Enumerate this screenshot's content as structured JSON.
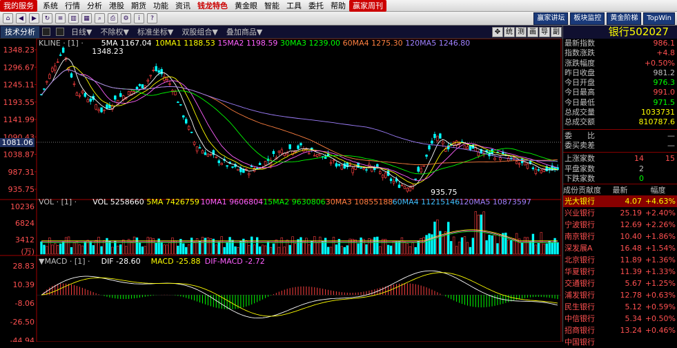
{
  "menubar": {
    "items": [
      "我的服务",
      "系统",
      "行情",
      "分析",
      "港股",
      "期货",
      "功能",
      "资讯",
      "钱龙特色",
      "黄金眼",
      "智能",
      "工具",
      "委托",
      "帮助",
      "赢家周刊"
    ]
  },
  "toolbar": {
    "right_buttons": [
      "赢家讲坛",
      "板块监控",
      "黄金阶梯",
      "TopWin"
    ]
  },
  "subbar": {
    "tab": "技术分析",
    "items": [
      "日线▼",
      "不除权▼",
      "标准坐标▼",
      "双股组合▼",
      "叠加商品▼"
    ],
    "right_buttons": [
      "✥",
      "统",
      "测",
      "画",
      "导",
      "副"
    ]
  },
  "stock": {
    "title": "银行502027"
  },
  "quote": [
    {
      "k": "最新指数",
      "v": "986.1",
      "c": "#ff5050"
    },
    {
      "k": "指数涨跌",
      "v": "+4.8",
      "c": "#ff5050"
    },
    {
      "k": "涨跌幅度",
      "v": "+0.50%",
      "c": "#ff5050"
    },
    {
      "k": "昨日收盘",
      "v": "981.2",
      "c": "#c0c0c0"
    },
    {
      "k": "今日开盘",
      "v": "976.3",
      "c": "#00ff00"
    },
    {
      "k": "今日最高",
      "v": "991.0",
      "c": "#ff5050"
    },
    {
      "k": "今日最低",
      "v": "971.5",
      "c": "#00ff00"
    },
    {
      "k": "总成交量",
      "v": "1033731",
      "c": "#ffff00"
    },
    {
      "k": "总成交额",
      "v": "810787.6",
      "c": "#ffff00"
    }
  ],
  "compare": [
    {
      "k": "委　　比",
      "v": "—"
    },
    {
      "k": "委买卖差",
      "v": "—"
    }
  ],
  "breadth": [
    {
      "k": "上涨家数",
      "v": "14",
      "v2": "15",
      "c": "#ff5050"
    },
    {
      "k": "平盘家数",
      "v": "2",
      "v2": "",
      "c": "#c0c0c0"
    },
    {
      "k": "下跌家数",
      "v": "0",
      "v2": "",
      "c": "#00ff00"
    }
  ],
  "contrib": {
    "headers": [
      "成份贡献度",
      "最新",
      "幅度"
    ],
    "rows": [
      {
        "n": "光大银行",
        "p": "4.07",
        "c": "+4.63%"
      },
      {
        "n": "兴业银行",
        "p": "25.19",
        "c": "+2.40%"
      },
      {
        "n": "宁波银行",
        "p": "12.69",
        "c": "+2.26%"
      },
      {
        "n": "南京银行",
        "p": "10.40",
        "c": "+1.86%"
      },
      {
        "n": "深发展A",
        "p": "16.48",
        "c": "+1.54%"
      },
      {
        "n": "北京银行",
        "p": "11.89",
        "c": "+1.36%"
      },
      {
        "n": "华夏银行",
        "p": "11.39",
        "c": "+1.33%"
      },
      {
        "n": "交通银行",
        "p": "5.67",
        "c": "+1.25%"
      },
      {
        "n": "浦发银行",
        "p": "12.78",
        "c": "+0.63%"
      },
      {
        "n": "民生银行",
        "p": "5.12",
        "c": "+0.59%"
      },
      {
        "n": "中信银行",
        "p": "5.34",
        "c": "+0.50%"
      },
      {
        "n": "招商银行",
        "p": "13.24",
        "c": "+0.46%"
      },
      {
        "n": "中国银行",
        "p": "",
        "c": ""
      }
    ]
  },
  "chart_data": [
    {
      "type": "line",
      "name": "kline",
      "legend": [
        {
          "t": "KLINE · [1] ·",
          "c": "#c0c0c0"
        },
        {
          "t": "5MA 1167.04",
          "c": "#ffffff"
        },
        {
          "t": "10MA1 1188.53",
          "c": "#ffff00"
        },
        {
          "t": "15MA2 1198.59",
          "c": "#ff60ff"
        },
        {
          "t": "30MA3 1239.00",
          "c": "#00ff00"
        },
        {
          "t": "60MA4 1275.30",
          "c": "#ff8040"
        },
        {
          "t": "120MA5 1246.80",
          "c": "#a080ff"
        }
      ],
      "yticks": [
        "1348.23",
        "1296.67",
        "1245.11",
        "1193.55",
        "1141.99",
        "1090.43",
        "1038.87",
        "987.31",
        "935.75"
      ],
      "cursor_label": "1081.06",
      "high_label": "1348.23",
      "low_label": "935.75",
      "ylim": [
        935.75,
        1348.23
      ]
    },
    {
      "type": "bar",
      "name": "volume",
      "legend": [
        {
          "t": "VOL · [1] ·",
          "c": "#c0c0c0"
        },
        {
          "t": "VOL 5258660",
          "c": "#ffffff"
        },
        {
          "t": "5MA 7426759",
          "c": "#ffff00"
        },
        {
          "t": "10MA1 9606804",
          "c": "#ff60ff"
        },
        {
          "t": "15MA2 9630806",
          "c": "#00ff00"
        },
        {
          "t": "30MA3 10855188",
          "c": "#ff8040"
        },
        {
          "t": "60MA4 11215146",
          "c": "#40c0ff"
        },
        {
          "t": "120MA5 10873597",
          "c": "#a080ff"
        }
      ],
      "yticks": [
        "10236",
        "6824",
        "3412",
        "(万)"
      ]
    },
    {
      "type": "line",
      "name": "macd",
      "legend": [
        {
          "t": "▼MACD · [1] ·",
          "c": "#c0c0c0"
        },
        {
          "t": "DIF -28.60",
          "c": "#ffffff"
        },
        {
          "t": "MACD -25.88",
          "c": "#ffff00"
        },
        {
          "t": "DIF-MACD -2.72",
          "c": "#ff60ff"
        }
      ],
      "yticks": [
        "28.83",
        "10.39",
        "-8.06",
        "-26.50",
        "-44.94"
      ]
    }
  ]
}
